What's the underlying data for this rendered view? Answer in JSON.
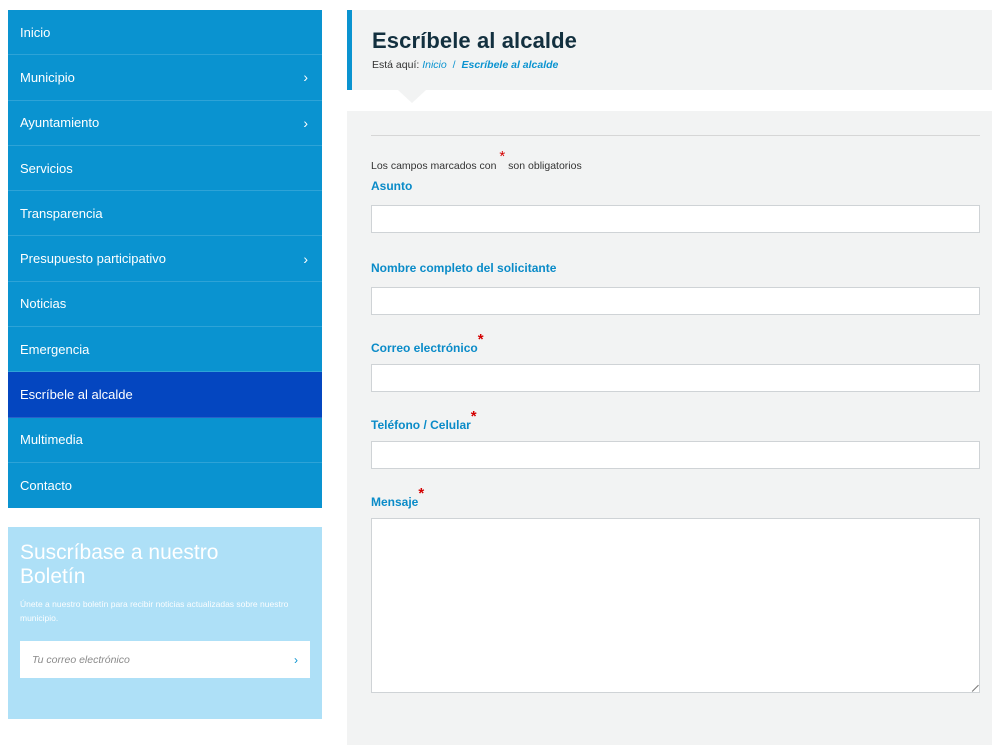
{
  "nav": {
    "items": [
      {
        "label": "Inicio",
        "chevron": ""
      },
      {
        "label": "Municipio",
        "chevron": "›"
      },
      {
        "label": "Ayuntamiento",
        "chevron": "›"
      },
      {
        "label": "Servicios",
        "chevron": ""
      },
      {
        "label": "Transparencia",
        "chevron": ""
      },
      {
        "label": "Presupuesto participativo",
        "chevron": "›"
      },
      {
        "label": "Noticias",
        "chevron": ""
      },
      {
        "label": "Emergencia",
        "chevron": ""
      },
      {
        "label": "Escríbele al alcalde",
        "chevron": ""
      },
      {
        "label": "Multimedia",
        "chevron": ""
      },
      {
        "label": "Contacto",
        "chevron": ""
      }
    ],
    "active_index": 8
  },
  "newsletter": {
    "title": "Suscríbase a nuestro Boletín",
    "description": "Únete a nuestro boletín para recibir noticias actualizadas sobre nuestro municipio.",
    "placeholder": "Tu correo electrónico",
    "submit_icon": "›"
  },
  "header": {
    "title": "Escríbele al alcalde",
    "breadcrumb_prefix": "Está aquí:",
    "breadcrumb_home": "Inicio",
    "breadcrumb_sep": "/",
    "breadcrumb_current": "Escríbele al alcalde"
  },
  "form": {
    "required_note_before": "Los campos marcados con",
    "required_note_after": "son obligatorios",
    "required_mark": "*",
    "fields": {
      "asunto": "Asunto",
      "nombre": "Nombre completo del solicitante",
      "correo": "Correo electrónico",
      "telefono": "Teléfono / Celular",
      "mensaje": "Mensaje"
    }
  },
  "colors": {
    "nav_bg": "#0a93d0",
    "nav_active": "#0446c0",
    "newsletter_bg": "#aee0f7",
    "label_color": "#0a8bc8",
    "required_star": "#d40000"
  }
}
